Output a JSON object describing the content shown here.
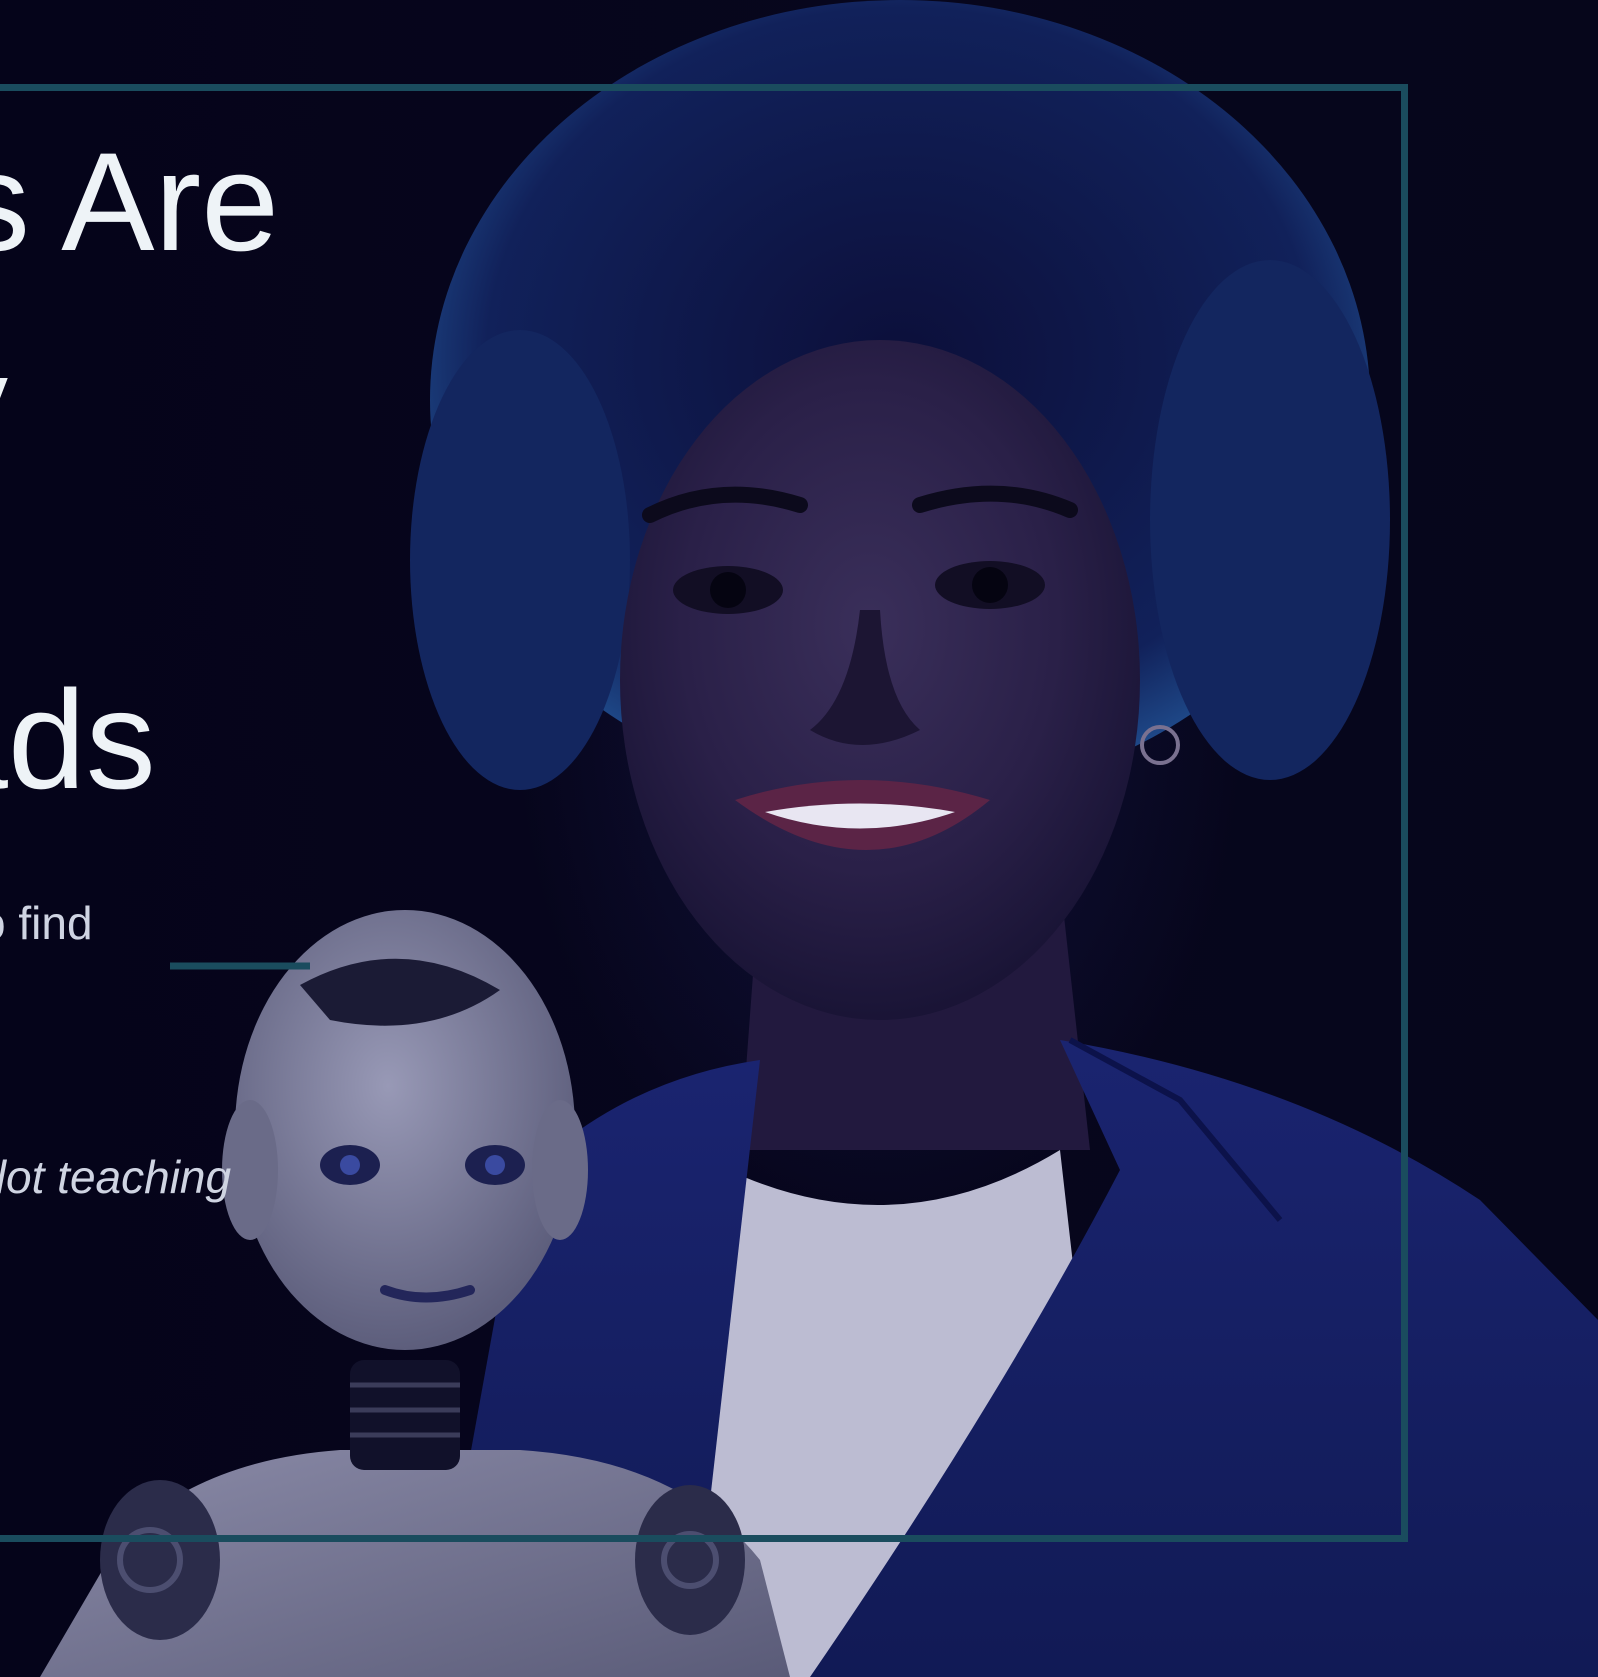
{
  "hero": {
    "headline_line1": "s Are",
    "headline_line2": "y",
    "headline_line3": "ads",
    "body_line1": "o find",
    "body_line2": ".",
    "caption": "pilot teaching"
  },
  "colors": {
    "background": "#06051a",
    "frame_border": "#1a4c5e",
    "headline_text": "#eef3f7",
    "body_text": "#cfd4e2"
  },
  "image": {
    "subjects": [
      "smiling-woman-portrait",
      "humanoid-robot"
    ]
  }
}
